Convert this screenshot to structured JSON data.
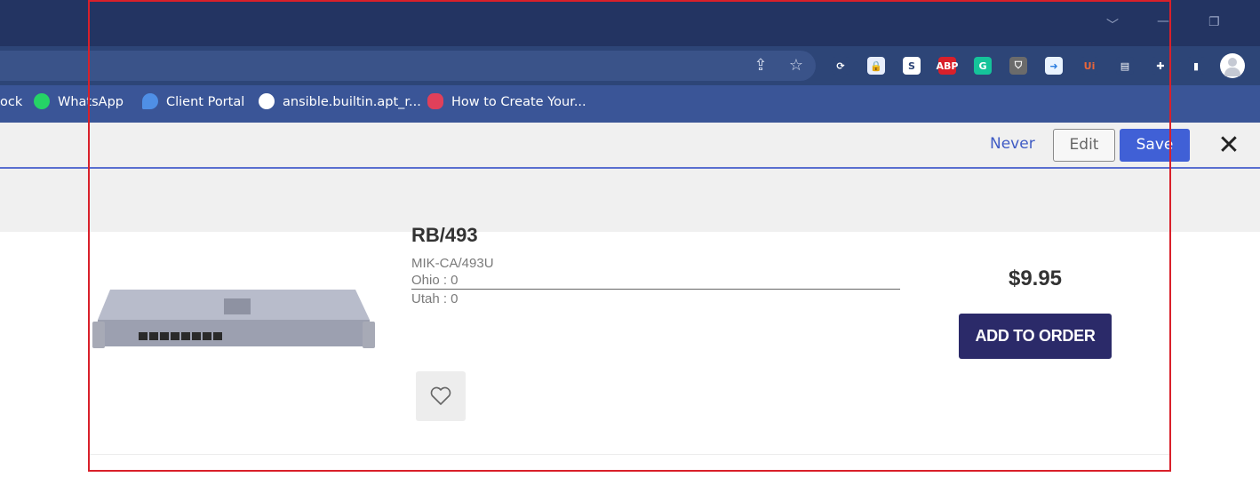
{
  "toolbar": {
    "never_label": "Never",
    "edit_label": "Edit",
    "save_label": "Save",
    "close_label": "✕"
  },
  "bookmarks": [
    {
      "label": "ock",
      "icon": "bookmark-icon"
    },
    {
      "label": "WhatsApp",
      "icon": "whatsapp-icon"
    },
    {
      "label": "Client Portal",
      "icon": "client-portal-icon"
    },
    {
      "label": "ansible.builtin.apt_r...",
      "icon": "globe-icon"
    },
    {
      "label": "How to Create Your...",
      "icon": "site-icon"
    }
  ],
  "extensions": [
    {
      "name": "sync-extension-icon",
      "text": "⟳",
      "bg": "#2d4577",
      "color": "#ffffff"
    },
    {
      "name": "lock-extension-icon",
      "text": "🔒",
      "bg": "#e8eefc",
      "color": "#2b5fd9"
    },
    {
      "name": "s-extension-icon",
      "text": "S",
      "bg": "#ffffff",
      "color": "#2d4577"
    },
    {
      "name": "adblock-plus-icon",
      "text": "ABP",
      "bg": "#d9202a",
      "color": "#ffffff"
    },
    {
      "name": "grammarly-icon",
      "text": "G",
      "bg": "#15c39a",
      "color": "#ffffff"
    },
    {
      "name": "shield-extension-icon",
      "text": "⛉",
      "bg": "#6b6b6b",
      "color": "#ffffff"
    },
    {
      "name": "screen-capture-icon",
      "text": "➜",
      "bg": "#e9f3ff",
      "color": "#2b7de0"
    },
    {
      "name": "uipath-icon",
      "text": "Ui",
      "bg": "#2d4577",
      "color": "#e8663a"
    },
    {
      "name": "document-extension-icon",
      "text": "▤",
      "bg": "#2d4577",
      "color": "#ffffff"
    },
    {
      "name": "puzzle-extensions-icon",
      "text": "✚",
      "bg": "#2d4577",
      "color": "#ffffff"
    },
    {
      "name": "side-panel-icon",
      "text": "▮",
      "bg": "#2d4577",
      "color": "#ffffff"
    }
  ],
  "product": {
    "title_partial": "RB/493",
    "sku": "MIK-CA/493U",
    "stock": [
      {
        "location": "Ohio : 0"
      },
      {
        "location": "Utah : 0"
      }
    ],
    "price": "$9.95",
    "add_to_order_label": "ADD TO ORDER"
  },
  "colors": {
    "tab_strip": "#233462",
    "address_bar": "#2d4577",
    "bookmarks_bar": "#3a5597",
    "accent_blue": "#4060d6",
    "add_button": "#2b2a69",
    "highlight_border": "#d9202a"
  }
}
